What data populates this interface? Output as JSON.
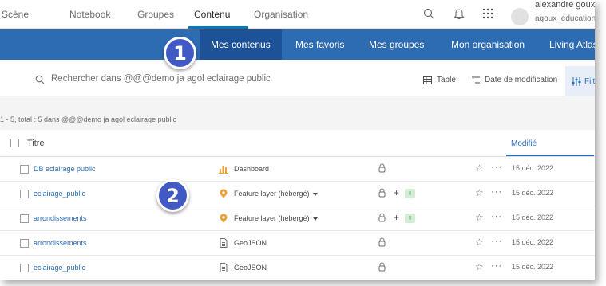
{
  "header": {
    "nav": [
      "Scène",
      "Notebook",
      "Groupes",
      "Contenu",
      "Organisation"
    ],
    "active_nav": "Contenu",
    "user_name": "alexandre goux",
    "user_login": "agoux_education"
  },
  "tabs": {
    "items": [
      "Mes contenus",
      "Mes favoris",
      "Mes groupes",
      "Mon organisation",
      "Living Atlas"
    ],
    "selected": "Mes contenus"
  },
  "search": {
    "placeholder": "Rechercher dans @@@demo ja agol eclairage public"
  },
  "toolbar": {
    "view_label": "Table",
    "sort_label": "Date de modification",
    "filter_label": "Filtre"
  },
  "results": {
    "count_text": "1 - 5, total : 5 dans @@@demo ja agol eclairage public"
  },
  "table": {
    "title_header": "Titre",
    "modified_header": "Modifié",
    "rows": [
      {
        "title": "DB eclairage public",
        "type": "Dashboard",
        "type_icon": "dashboard-icon",
        "has_dropdown": false,
        "has_tag": false,
        "date": "15 déc. 2022"
      },
      {
        "title": "eclairage_public",
        "type": "Feature layer (hébergé)",
        "type_icon": "feature-layer-icon",
        "has_dropdown": true,
        "has_tag": true,
        "date": "15 déc. 2022"
      },
      {
        "title": "arrondissements",
        "type": "Feature layer (hébergé)",
        "type_icon": "feature-layer-icon",
        "has_dropdown": true,
        "has_tag": true,
        "date": "15 déc. 2022"
      },
      {
        "title": "arrondissements",
        "type": "GeoJSON",
        "type_icon": "file-icon",
        "has_dropdown": false,
        "has_tag": false,
        "date": "15 déc. 2022"
      },
      {
        "title": "eclairage_public",
        "type": "GeoJSON",
        "type_icon": "file-icon",
        "has_dropdown": false,
        "has_tag": false,
        "date": "15 déc. 2022"
      }
    ]
  },
  "callouts": [
    "1",
    "2"
  ],
  "colors": {
    "tab_bar": "#2d6cb3",
    "tab_selected": "#1e5298",
    "link": "#2d6cb3",
    "callout": "#4159c2"
  }
}
